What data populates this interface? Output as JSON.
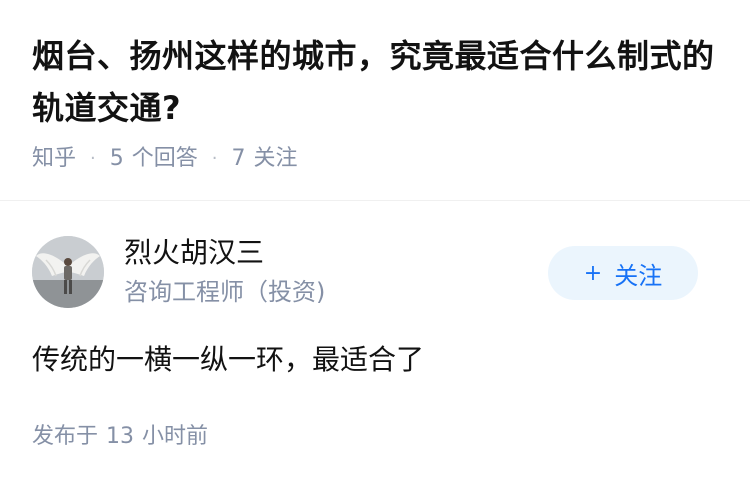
{
  "question": {
    "title": "烟台、扬州这样的城市，究竟最适合什么制式的轨道交通?",
    "source": "知乎",
    "answer_count": "5",
    "answer_label": "个回答",
    "follow_count": "7",
    "follow_label": "关注"
  },
  "answer": {
    "author_name": "烈火胡汉三",
    "author_bio": "咨询工程师（投资)",
    "follow_button_plus": "+",
    "follow_button_label": "关注",
    "content": "传统的一横一纵一环，最适合了",
    "time_prefix": "发布于",
    "time_value": "13",
    "time_unit": "小时前"
  },
  "colors": {
    "title": "#121212",
    "meta": "#8590a6",
    "follow_bg": "#ebf5fd",
    "follow_text": "#1772f6"
  }
}
